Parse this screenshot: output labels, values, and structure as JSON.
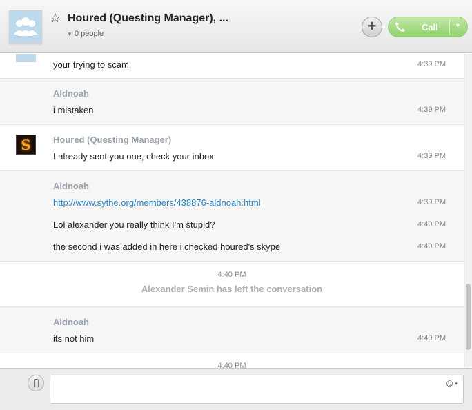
{
  "header": {
    "title": "Houred (Questing Manager), ...",
    "people": "0 people",
    "call_label": "Call"
  },
  "messages": {
    "b0": {
      "text": "your trying to scam",
      "time": "4:39 PM"
    },
    "b1": {
      "sender": "Aldnoah",
      "text": "i mistaken",
      "time": "4:39 PM"
    },
    "b2": {
      "sender": "Houred (Questing Manager)",
      "avatar_letter": "S",
      "text": "I already sent you one, check your inbox",
      "time": "4:39 PM"
    },
    "b3": {
      "sender": "Aldnoah",
      "lines": [
        {
          "text": "http://www.sythe.org/members/438876-aldnoah.html",
          "time": "4:39 PM"
        },
        {
          "text": "Lol alexander you really think I'm stupid?",
          "time": "4:40 PM"
        },
        {
          "text": "the second i was added in here i checked houred's skype",
          "time": "4:40 PM"
        }
      ]
    },
    "b4": {
      "time": "4:40 PM",
      "event": "Alexander Semin has left the conversation"
    },
    "b5": {
      "sender": "Aldnoah",
      "text": "its not him",
      "time": "4:40 PM"
    },
    "b6": {
      "time": "4:40 PM"
    }
  },
  "colors": {
    "link": "#2a86c8",
    "call_green": "#93d16d",
    "sender_gray": "#9aa3ab"
  }
}
